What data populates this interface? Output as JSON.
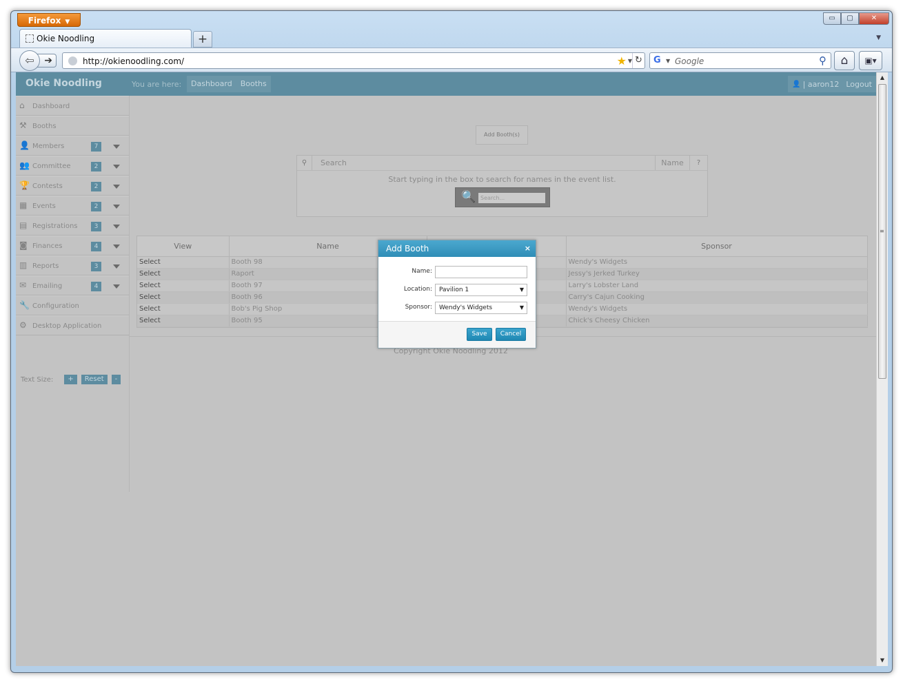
{
  "browser": {
    "menu_label": "Firefox",
    "tab_title": "Okie Noodling",
    "new_tab": "+",
    "url": "http://okienoodling.com/",
    "search_placeholder": "Google",
    "window_controls": {
      "minimize": "▭",
      "restore": "▢",
      "close": "✕"
    }
  },
  "header": {
    "brand": "Okie Noodling",
    "breadcrumb_label": "You are here:",
    "breadcrumbs": [
      "Dashboard",
      "Booths"
    ],
    "user": "| aaron12",
    "logout": "Logout"
  },
  "sidebar": {
    "items": [
      {
        "label": "Dashboard",
        "icon": "home-icon",
        "glyph": "⌂"
      },
      {
        "label": "Booths",
        "icon": "booth-icon",
        "glyph": "⚒"
      },
      {
        "label": "Members",
        "icon": "user-icon",
        "glyph": "👤",
        "badge": "7"
      },
      {
        "label": "Committee",
        "icon": "group-icon",
        "glyph": "👥",
        "badge": "2"
      },
      {
        "label": "Contests",
        "icon": "trophy-icon",
        "glyph": "🏆",
        "badge": "2"
      },
      {
        "label": "Events",
        "icon": "calendar-icon",
        "glyph": "▦",
        "badge": "2"
      },
      {
        "label": "Registrations",
        "icon": "book-icon",
        "glyph": "▤",
        "badge": "3"
      },
      {
        "label": "Finances",
        "icon": "money-icon",
        "glyph": "◙",
        "badge": "4"
      },
      {
        "label": "Reports",
        "icon": "chart-icon",
        "glyph": "▥",
        "badge": "3"
      },
      {
        "label": "Emailing",
        "icon": "envelope-icon",
        "glyph": "✉",
        "badge": "4"
      },
      {
        "label": "Configuration",
        "icon": "wrench-icon",
        "glyph": "🔧"
      },
      {
        "label": "Desktop Application",
        "icon": "cogs-icon",
        "glyph": "⚙"
      }
    ],
    "text_size_label": "Text Size:",
    "text_size_plus": "+",
    "text_size_reset": "Reset",
    "text_size_minus": "-"
  },
  "main": {
    "add_button": "Add Booth(s)",
    "search": {
      "placeholder": "Search",
      "column": "Name",
      "help": "?",
      "hint": "Start typing in the box to search for names in the event list.",
      "small_placeholder": "Search..."
    },
    "table": {
      "headers": [
        "View",
        "Name",
        "",
        "Sponsor"
      ],
      "rows": [
        [
          "Select",
          "Booth 98",
          "",
          "Wendy's Widgets"
        ],
        [
          "Select",
          "Raport",
          "",
          "Jessy's Jerked Turkey"
        ],
        [
          "Select",
          "Booth 97",
          "",
          "Larry's Lobster Land"
        ],
        [
          "Select",
          "Booth 96",
          "",
          "Carry's Cajun Cooking"
        ],
        [
          "Select",
          "Bob's Pig Shop",
          "",
          "Wendy's Widgets"
        ],
        [
          "Select",
          "Booth 95",
          "",
          "Chick's Cheesy Chicken"
        ]
      ]
    },
    "copyright": "Copyright Okie Noodling  2012"
  },
  "modal": {
    "title": "Add Booth",
    "close": "×",
    "name_label": "Name:",
    "name_value": "",
    "location_label": "Location:",
    "location_value": "Pavilion 1",
    "sponsor_label": "Sponsor:",
    "sponsor_value": "Wendy's Widgets",
    "save": "Save",
    "cancel": "Cancel"
  },
  "colors": {
    "header": "#5d8ca0",
    "modal_header": "#3a9bc5",
    "overlay": "#c3c3c3",
    "firefox_button": "#e77c16"
  }
}
